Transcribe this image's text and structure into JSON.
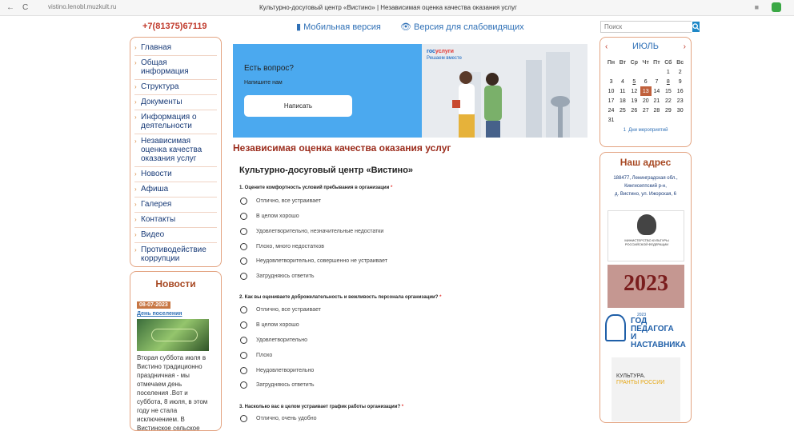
{
  "browser": {
    "back": "←",
    "reload": "C",
    "url": "vistino.lenobl.muzkult.ru",
    "title": "Культурно-досуговый центр «Вистино» | Независимая оценка качества оказания услуг"
  },
  "header": {
    "phone": "+7(81375)67119",
    "mobile": "Мобильная версия",
    "impaired": "Версия для слабовидящих",
    "search_placeholder": "Поиск"
  },
  "menu": [
    "Главная",
    "Общая информация",
    "Структура",
    "Документы",
    "Информация о деятельности",
    "Независимая оценка качества оказания услуг",
    "Новости",
    "Афиша",
    "Галерея",
    "Контакты",
    "Видео",
    "Противодействие коррупции"
  ],
  "news": {
    "title": "Новости",
    "date": "08-07-2023",
    "link": "День поселения",
    "text": "Вторая суббота июля в Вистино традиционно праздничная - мы отмечаем день поселения .Вот и суббота, 8 июля, в этом году не стала исключением. В Вистинское сельское"
  },
  "banner": {
    "question": "Есть вопрос?",
    "sub": "Напишите нам",
    "button": "Написать",
    "gos_a": "гос",
    "gos_b": "услуги",
    "gos_sub": "Решаем вместе"
  },
  "main": {
    "title": "Независимая оценка качества оказания услуг",
    "org": "Культурно-досуговый центр «Вистино»",
    "questions": [
      {
        "q": "1. Оцените комфортность условий пребывания в организации",
        "options": [
          "Отлично, все устраивает",
          "В целом хорошо",
          "Удовлетворительно, незначительные недостатки",
          "Плохо, много недостатков",
          "Неудовлетворительно, совершенно не устраивает",
          "Затрудняюсь ответить"
        ]
      },
      {
        "q": "2. Как вы оцениваете доброжелательность и вежливость персонала организации?",
        "options": [
          "Отлично, все устраивает",
          "В целом хорошо",
          "Удовлетворительно",
          "Плохо",
          "Неудовлетворительно",
          "Затрудняюсь ответить"
        ]
      },
      {
        "q": "3. Насколько вас в целом устраивает график работы организации?",
        "options": [
          "Отлично, очень удобно"
        ]
      }
    ],
    "required_mark": "*"
  },
  "calendar": {
    "prev": "‹",
    "next": "›",
    "month": "ИЮЛЬ",
    "dow": [
      "Пн",
      "Вт",
      "Ср",
      "Чт",
      "Пт",
      "Сб",
      "Вс"
    ],
    "weeks": [
      [
        "",
        "",
        "",
        "",
        "",
        "1",
        "2"
      ],
      [
        "3",
        "4",
        "5",
        "6",
        "7",
        "8",
        "9"
      ],
      [
        "10",
        "11",
        "12",
        "13",
        "14",
        "15",
        "16"
      ],
      [
        "17",
        "18",
        "19",
        "20",
        "21",
        "22",
        "23"
      ],
      [
        "24",
        "25",
        "26",
        "27",
        "28",
        "29",
        "30"
      ],
      [
        "31",
        "",
        "",
        "",
        "",
        "",
        ""
      ]
    ],
    "underlined": [
      "5",
      "8"
    ],
    "today": "13",
    "events_count": "1",
    "events_label": "Дни мероприятий"
  },
  "address": {
    "title": "Наш адрес",
    "lines": [
      "188477, Ленинградская обл.,",
      "Кингисеппский р-н,",
      "д. Вистино, ул. Ижорская, 6"
    ]
  },
  "logos": {
    "ministry": "МИНИСТЕРСТВО КУЛЬТУРЫ РОССИЙСКОЙ ФЕДЕРАЦИИ",
    "year": "2023",
    "year_sub": "ГОД",
    "teacher_year": "2023",
    "teacher_1": "ГОД ПЕДАГОГА",
    "teacher_2": "И НАСТАВНИКА",
    "grants_1": "КУЛЬТУРА.",
    "grants_2": "ГРАНТЫ РОССИИ"
  },
  "colors": {
    "accent": "#9b2c1c",
    "link": "#2f70b6",
    "border": "#e3a482",
    "today": "#c0603c"
  }
}
